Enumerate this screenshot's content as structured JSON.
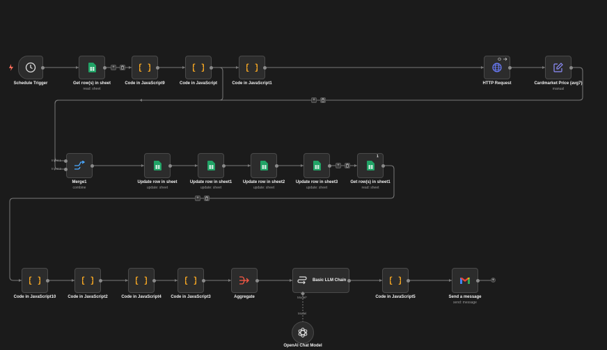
{
  "canvas": {
    "background": "#1b1b1b",
    "accent_trigger": "#ff6d5a",
    "sheets_green": "#21a366",
    "code_orange": "#f5a623",
    "http_blue": "#6b7dff",
    "aggregate_red": "#ff5a45"
  },
  "nodes": {
    "schedule_trigger": {
      "label": "Schedule Trigger",
      "icon": "clock-icon"
    },
    "get_rows": {
      "label": "Get row(s) in sheet",
      "sub": "read: sheet",
      "icon": "google-sheets-icon"
    },
    "code9": {
      "label": "Code in JavaScript9",
      "icon": "code-braces-icon"
    },
    "code": {
      "label": "Code in JavaScript",
      "icon": "code-braces-icon"
    },
    "code1": {
      "label": "Code in JavaScript1",
      "icon": "code-braces-icon"
    },
    "http": {
      "label": "HTTP Request",
      "icon": "globe-icon"
    },
    "cardmarket": {
      "label": "Cardmarket Price (avg7)",
      "sub": "manual",
      "icon": "pencil-edit-icon"
    },
    "merge": {
      "label": "Merge1",
      "sub": "combine",
      "icon": "merge-icon",
      "input1": "Input 1",
      "input2": "Input 2"
    },
    "update_row": {
      "label": "Update row in sheet",
      "sub": "update: sheet",
      "icon": "google-sheets-icon"
    },
    "update_row1": {
      "label": "Update row in sheet1",
      "sub": "update: sheet",
      "icon": "google-sheets-icon"
    },
    "update_row2": {
      "label": "Update row in sheet2",
      "sub": "update: sheet",
      "icon": "google-sheets-icon"
    },
    "update_row3": {
      "label": "Update row in sheet3",
      "sub": "update: sheet",
      "icon": "google-sheets-icon"
    },
    "get_rows1": {
      "label": "Get row(s) in sheet1",
      "sub": "read: sheet",
      "icon": "google-sheets-icon",
      "badge": "1"
    },
    "code10": {
      "label": "Code in JavaScript10",
      "icon": "code-braces-icon"
    },
    "code2": {
      "label": "Code in JavaScript2",
      "icon": "code-braces-icon"
    },
    "code4": {
      "label": "Code in JavaScript4",
      "icon": "code-braces-icon"
    },
    "code3": {
      "label": "Code in JavaScript3",
      "icon": "code-braces-icon"
    },
    "aggregate": {
      "label": "Aggregate",
      "icon": "aggregate-icon"
    },
    "llm": {
      "label": "Basic LLM Chain",
      "icon": "llm-chain-icon",
      "model_port": "Model*"
    },
    "code5": {
      "label": "Code in JavaScript5",
      "icon": "code-braces-icon"
    },
    "gmail": {
      "label": "Send a message",
      "sub": "send: message",
      "icon": "gmail-icon"
    },
    "openai": {
      "label": "OpenAI Chat Model",
      "icon": "openai-icon",
      "model_label": "Model"
    }
  },
  "controls": {
    "add": "+",
    "delete": "🗑"
  }
}
